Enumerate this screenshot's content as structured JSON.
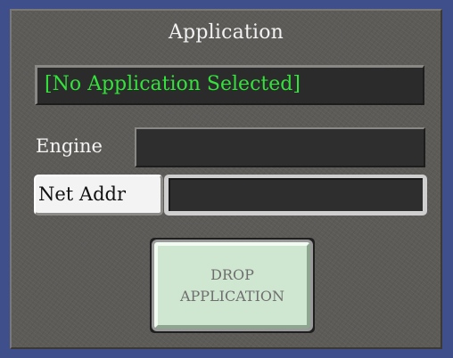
{
  "panel": {
    "title": "Application",
    "application_display": "[No Application Selected]",
    "engine_label": "Engine",
    "engine_value": "",
    "net_addr_label": "Net Addr",
    "net_addr_value": "",
    "drop_button": {
      "line1": "DROP",
      "line2": "APPLICATION"
    }
  },
  "colors": {
    "frame": "#3f4f8c",
    "panel_bg": "#5d5b58",
    "display_text": "#34e23c",
    "button_face": "#cfe7d0"
  }
}
